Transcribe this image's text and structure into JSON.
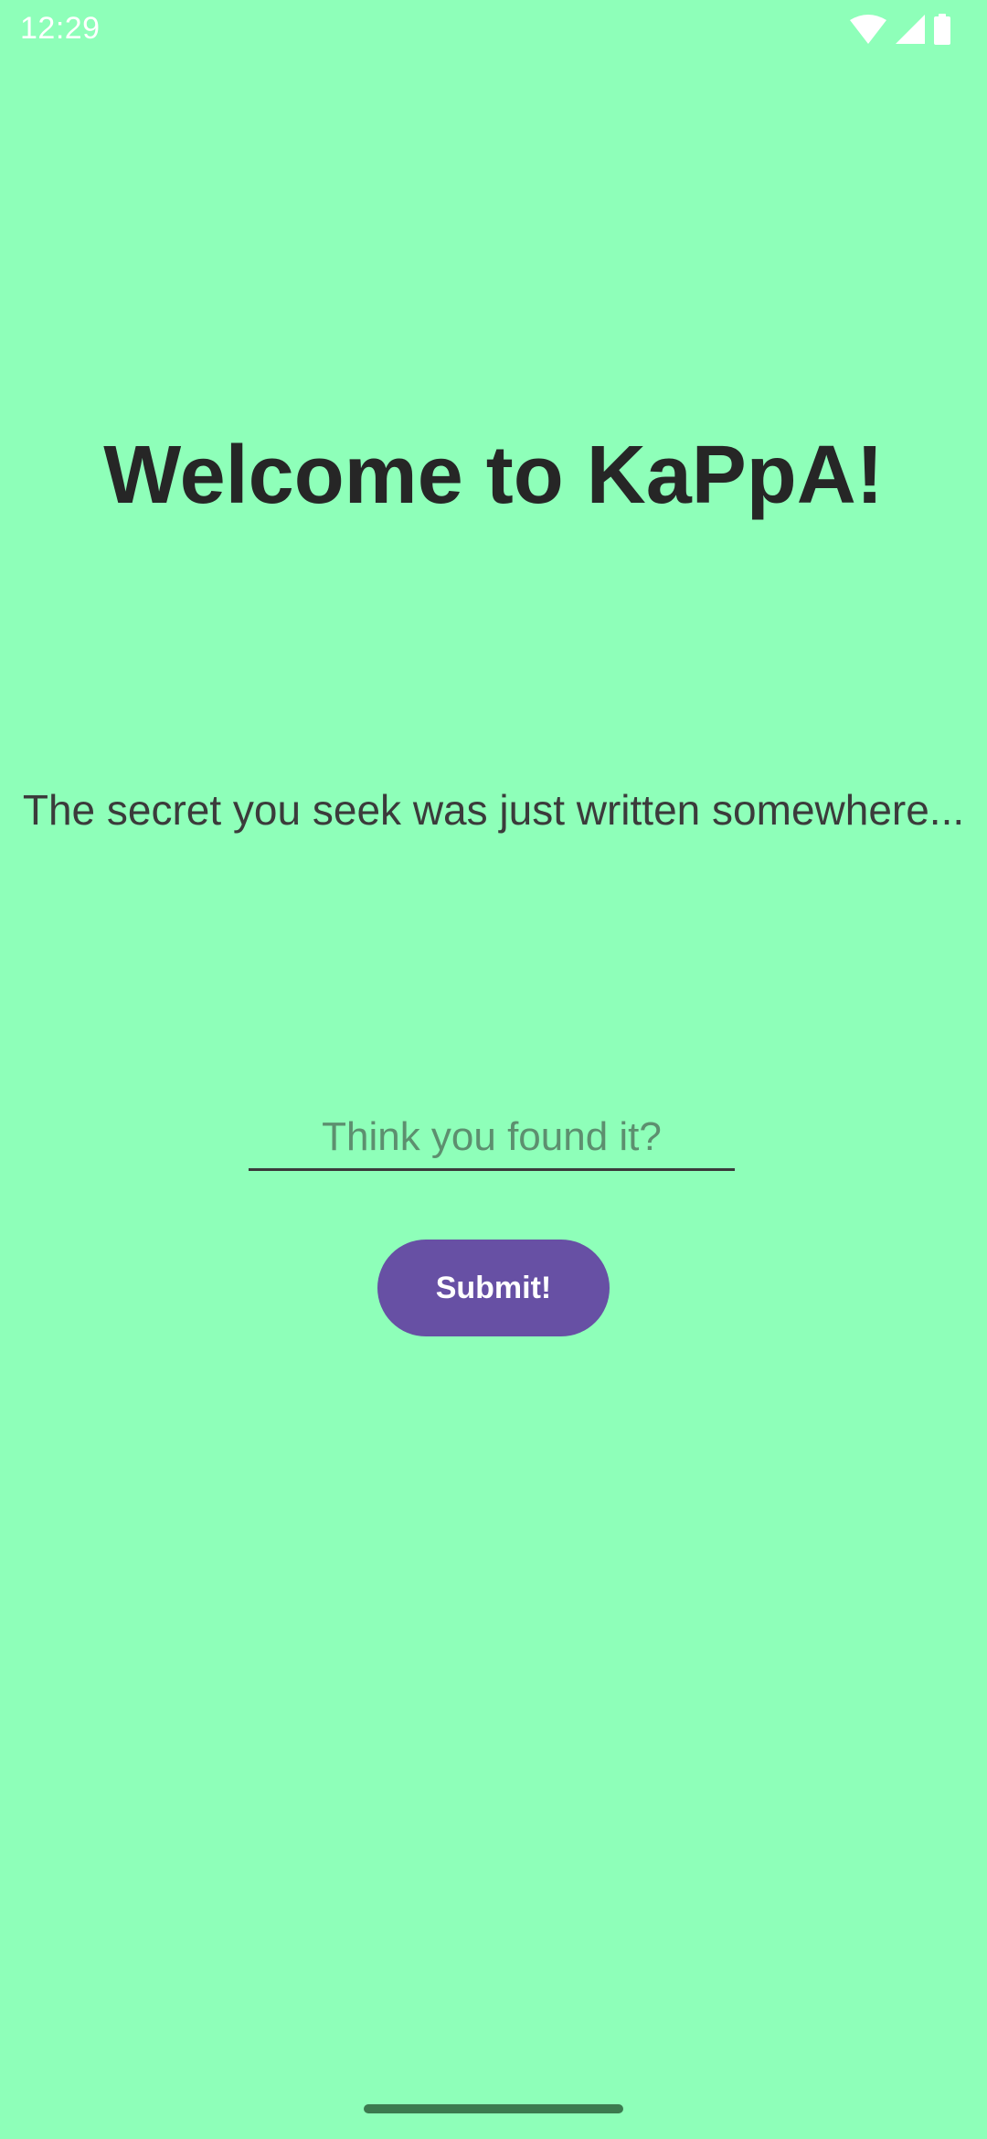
{
  "status_bar": {
    "time": "12:29",
    "icons": [
      "wifi-icon",
      "cellular-signal-icon",
      "battery-icon"
    ]
  },
  "main": {
    "title": "Welcome to KaPpA!",
    "subtitle": "The secret you seek was just written somewhere...",
    "input_placeholder": "Think you found it?",
    "input_value": "",
    "submit_label": "Submit!"
  },
  "colors": {
    "background": "#8effb9",
    "button": "#6750a4",
    "button_text": "#ffffff",
    "title_text": "#262626"
  }
}
